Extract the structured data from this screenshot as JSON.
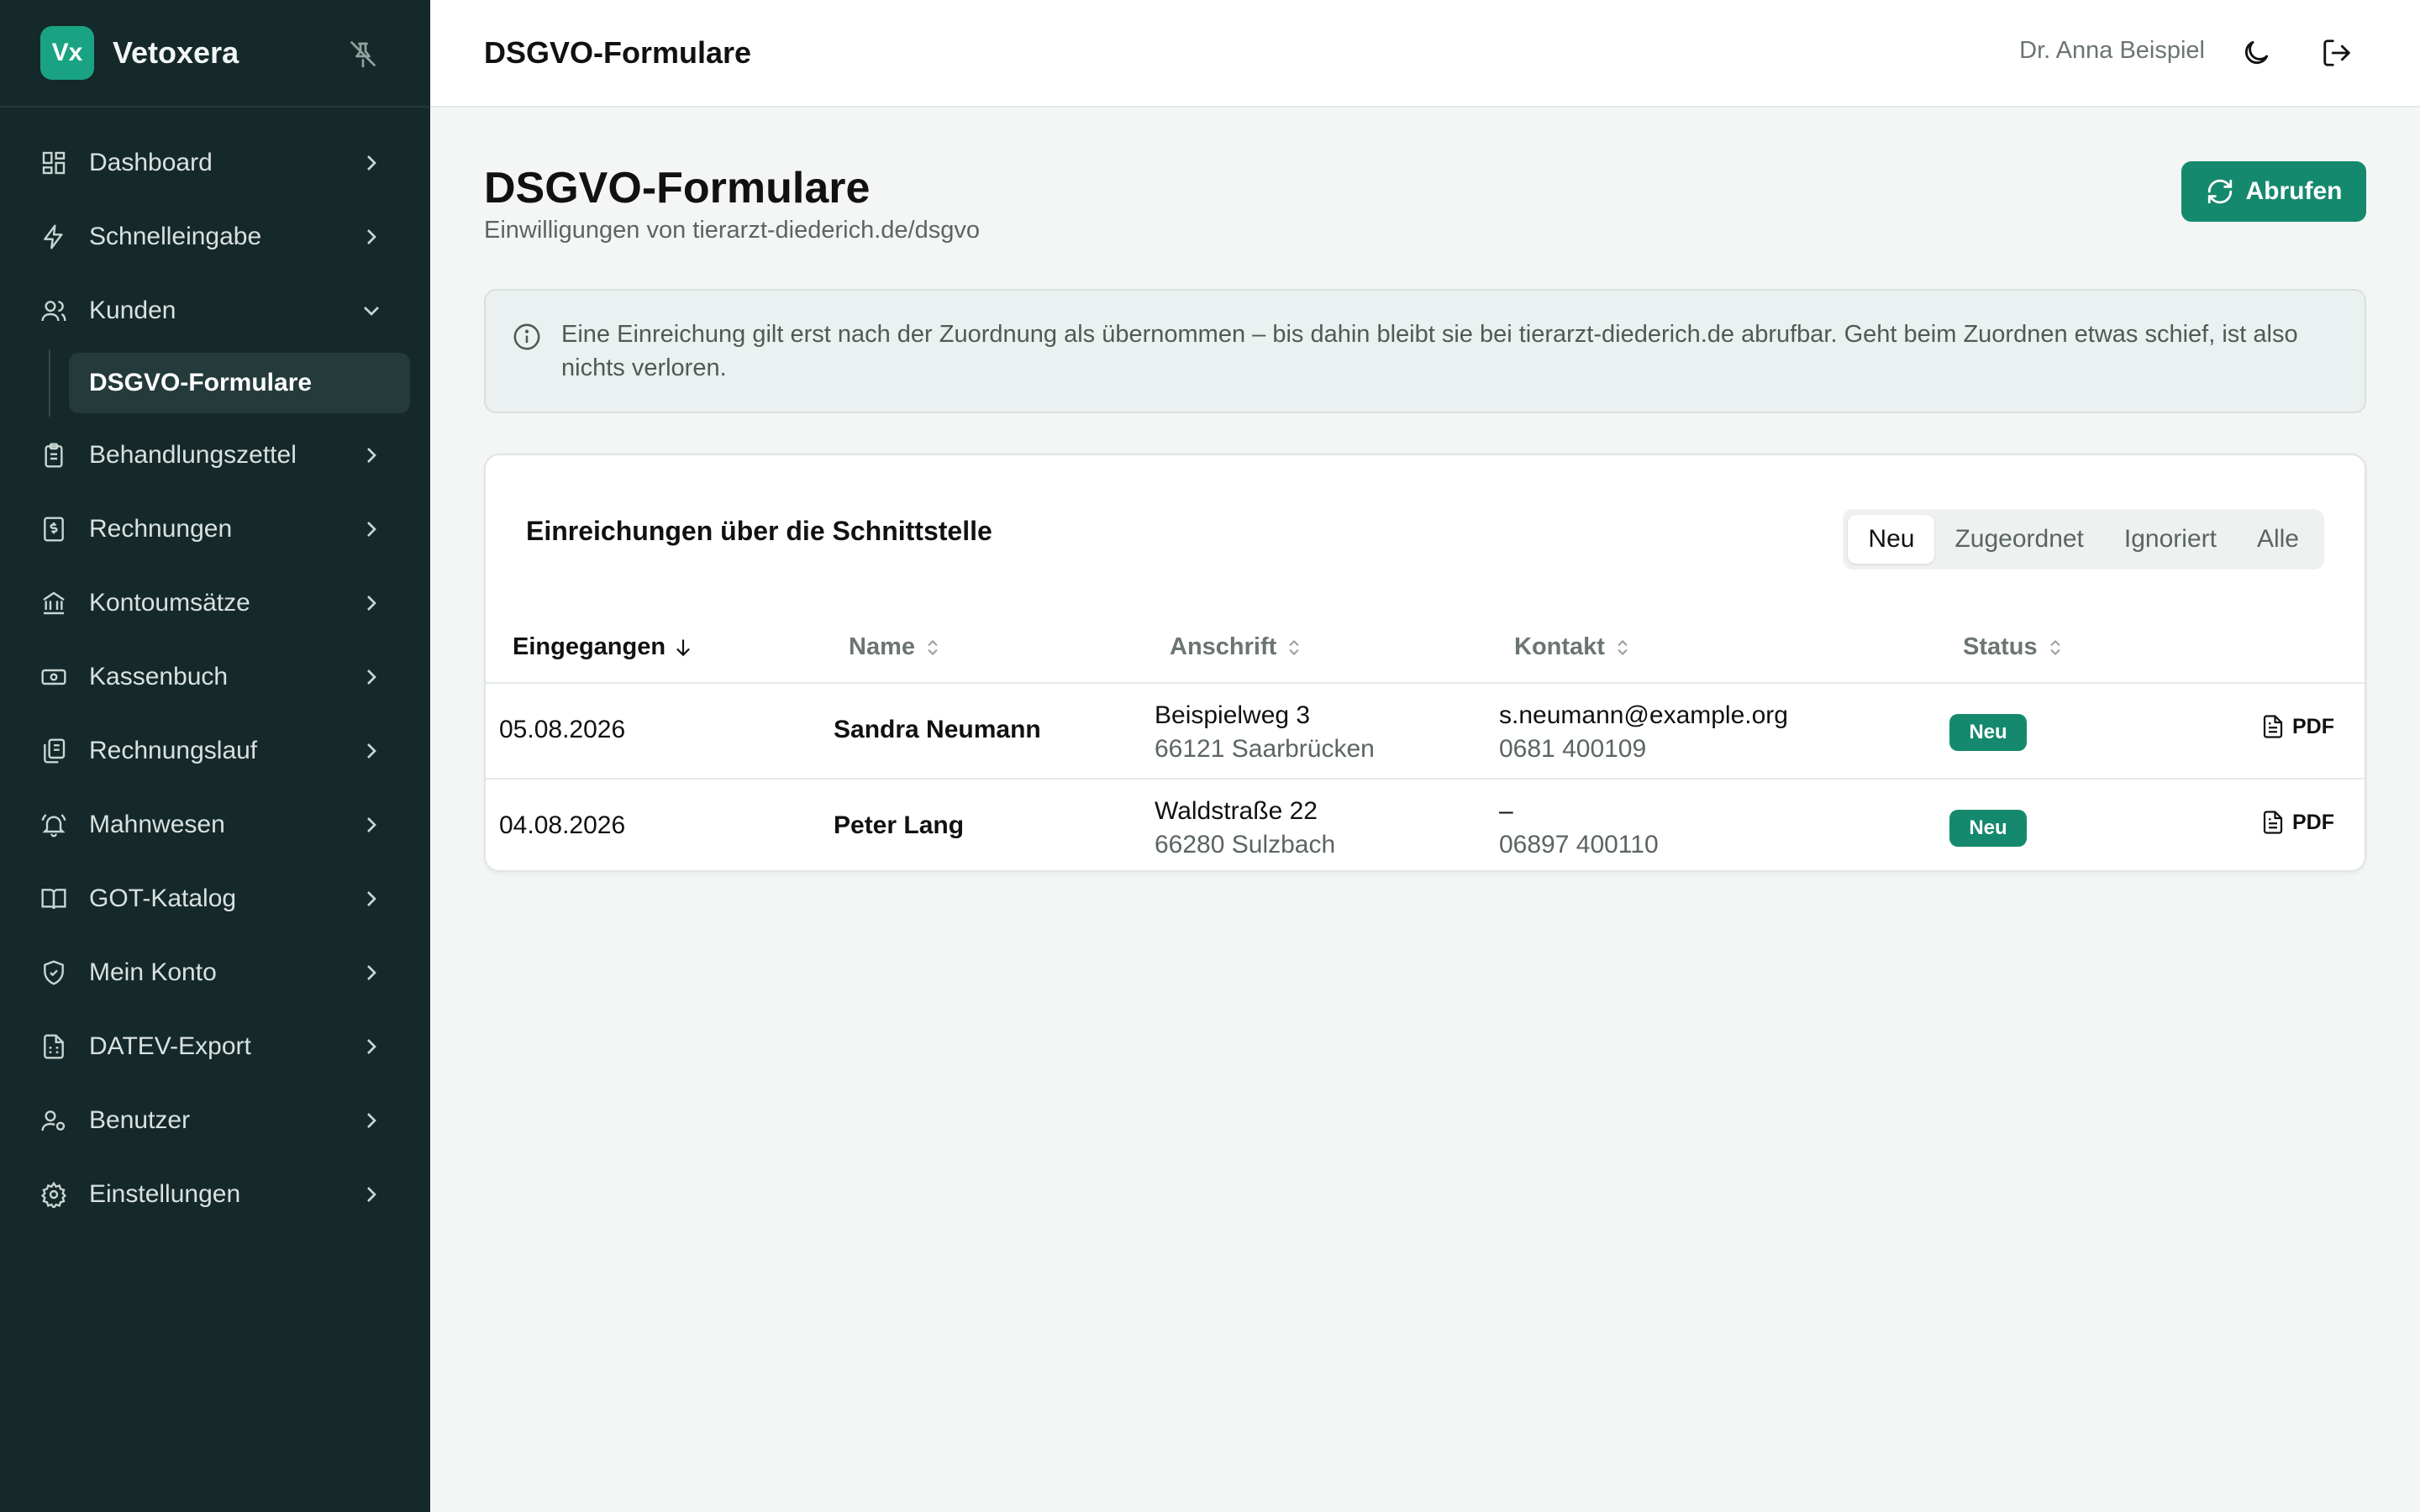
{
  "app": {
    "logo_text": "Vx",
    "name": "Vetoxera"
  },
  "sidebar": {
    "items": [
      {
        "label": "Dashboard",
        "icon": "dashboard-icon"
      },
      {
        "label": "Schnelleingabe",
        "icon": "bolt-icon"
      },
      {
        "label": "Kunden",
        "icon": "users-icon",
        "expanded": true
      },
      {
        "label": "Behandlungszettel",
        "icon": "clipboard-icon"
      },
      {
        "label": "Rechnungen",
        "icon": "invoice-icon"
      },
      {
        "label": "Kontoumsätze",
        "icon": "bank-icon"
      },
      {
        "label": "Kassenbuch",
        "icon": "cash-icon"
      },
      {
        "label": "Rechnungslauf",
        "icon": "documents-icon"
      },
      {
        "label": "Mahnwesen",
        "icon": "bell-icon"
      },
      {
        "label": "GOT-Katalog",
        "icon": "book-icon"
      },
      {
        "label": "Mein Konto",
        "icon": "shield-icon"
      },
      {
        "label": "DATEV-Export",
        "icon": "file-export-icon"
      },
      {
        "label": "Benutzer",
        "icon": "user-gear-icon"
      },
      {
        "label": "Einstellungen",
        "icon": "gear-icon"
      }
    ],
    "sub_active": "DSGVO-Formulare"
  },
  "topbar": {
    "title": "DSGVO-Formulare",
    "user": "Dr. Anna Beispiel"
  },
  "page": {
    "title": "DSGVO-Formulare",
    "subtitle": "Einwilligungen von tierarzt-diederich.de/dsgvo",
    "fetch_button": "Abrufen",
    "info": "Eine Einreichung gilt erst nach der Zuordnung als übernommen – bis dahin bleibt sie bei tierarzt-diederich.de abrufbar. Geht beim Zuordnen etwas schief, ist also nichts verloren."
  },
  "card": {
    "title": "Einreichungen über die Schnittstelle",
    "tabs": [
      "Neu",
      "Zugeordnet",
      "Ignoriert",
      "Alle"
    ],
    "active_tab": "Neu",
    "columns": [
      "Eingegangen",
      "Name",
      "Anschrift",
      "Kontakt",
      "Status"
    ],
    "rows": [
      {
        "date": "05.08.2026",
        "name": "Sandra Neumann",
        "street": "Beispielweg 3",
        "city": "66121 Saarbrücken",
        "email": "s.neumann@example.org",
        "phone": "0681 400109",
        "status": "Neu",
        "pdf": "PDF"
      },
      {
        "date": "04.08.2026",
        "name": "Peter Lang",
        "street": "Waldstraße 22",
        "city": "66280 Sulzbach",
        "email": "–",
        "phone": "06897 400110",
        "status": "Neu",
        "pdf": "PDF"
      }
    ]
  },
  "colors": {
    "sidebar_bg": "#15282a",
    "accent": "#15896d",
    "logo": "#1aa383"
  }
}
